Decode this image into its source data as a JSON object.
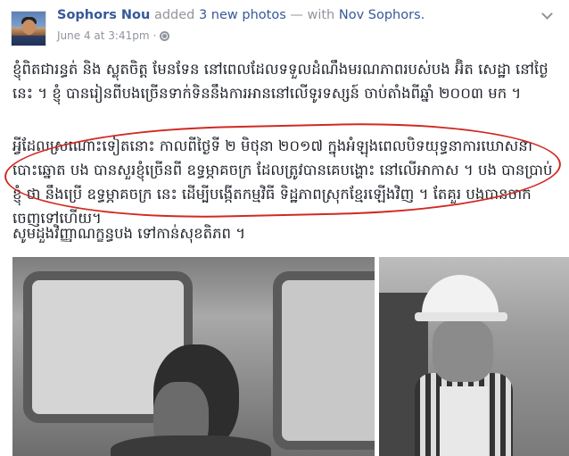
{
  "post": {
    "author": "Sophors Nou",
    "action": "added",
    "photo_count": "3 new photos",
    "with_text": "— with",
    "tagged": "Nov Sophors.",
    "timestamp": "June 4 at 3:41pm",
    "separator": "·"
  },
  "content": {
    "paragraph1": "ខ្ញុំពិតជារន្ធត់ និង ស្លុតចិត្ត មែនទែន នៅពេលដែលទទួលដំណឹងមរណភាពរបស់បង អ៊ិត សេដ្ឋា នៅថ្ងៃនេះ ។ ខ្ញុំ បានរៀនពីបងច្រើនទាក់ទិននឹងការអាននៅលើទូរទស្សន៍ ចាប់តាំងពីឆ្នាំ ២០០៣ មក ។",
    "paragraph2": "អ្វីដែលស្រណោះទៀតនោះ កាលពីថ្ងៃទី ២ មិថុនា ២០១៧ ក្នុងអំឡុងពេលបិទយុទ្ធនាការឃោសនាបោះឆ្នោត បង បានសួរខ្ញុំច្រើនពី ឧទ្ធម្ភាគចក្រ ដែលត្រូវបានគេបង្ហោះ នៅលើអាកាស ។ បង បានប្រាប់ខ្ញុំ ថា នឹងប្រើ ឧទ្ធម្ភាគចក្រ នេះ ដើម្បីបង្កើតកម្មវិធី ទិដ្ឋភាពស្រុកខ្មែរឡើងវិញ ។ តែគួរ បងបានចាកចេញទៅហើយ។",
    "paragraph3": "សូមដួងវិញ្ញាណក្ខន្ធបង ទៅកាន់សុខតិភព ។"
  },
  "icons": {
    "audience": "globe-icon",
    "menu": "chevron-down-icon"
  },
  "colors": {
    "author_link": "#365899",
    "meta_gray": "#90949c",
    "body_text": "#1d2129",
    "highlight_circle": "#d02a22"
  }
}
